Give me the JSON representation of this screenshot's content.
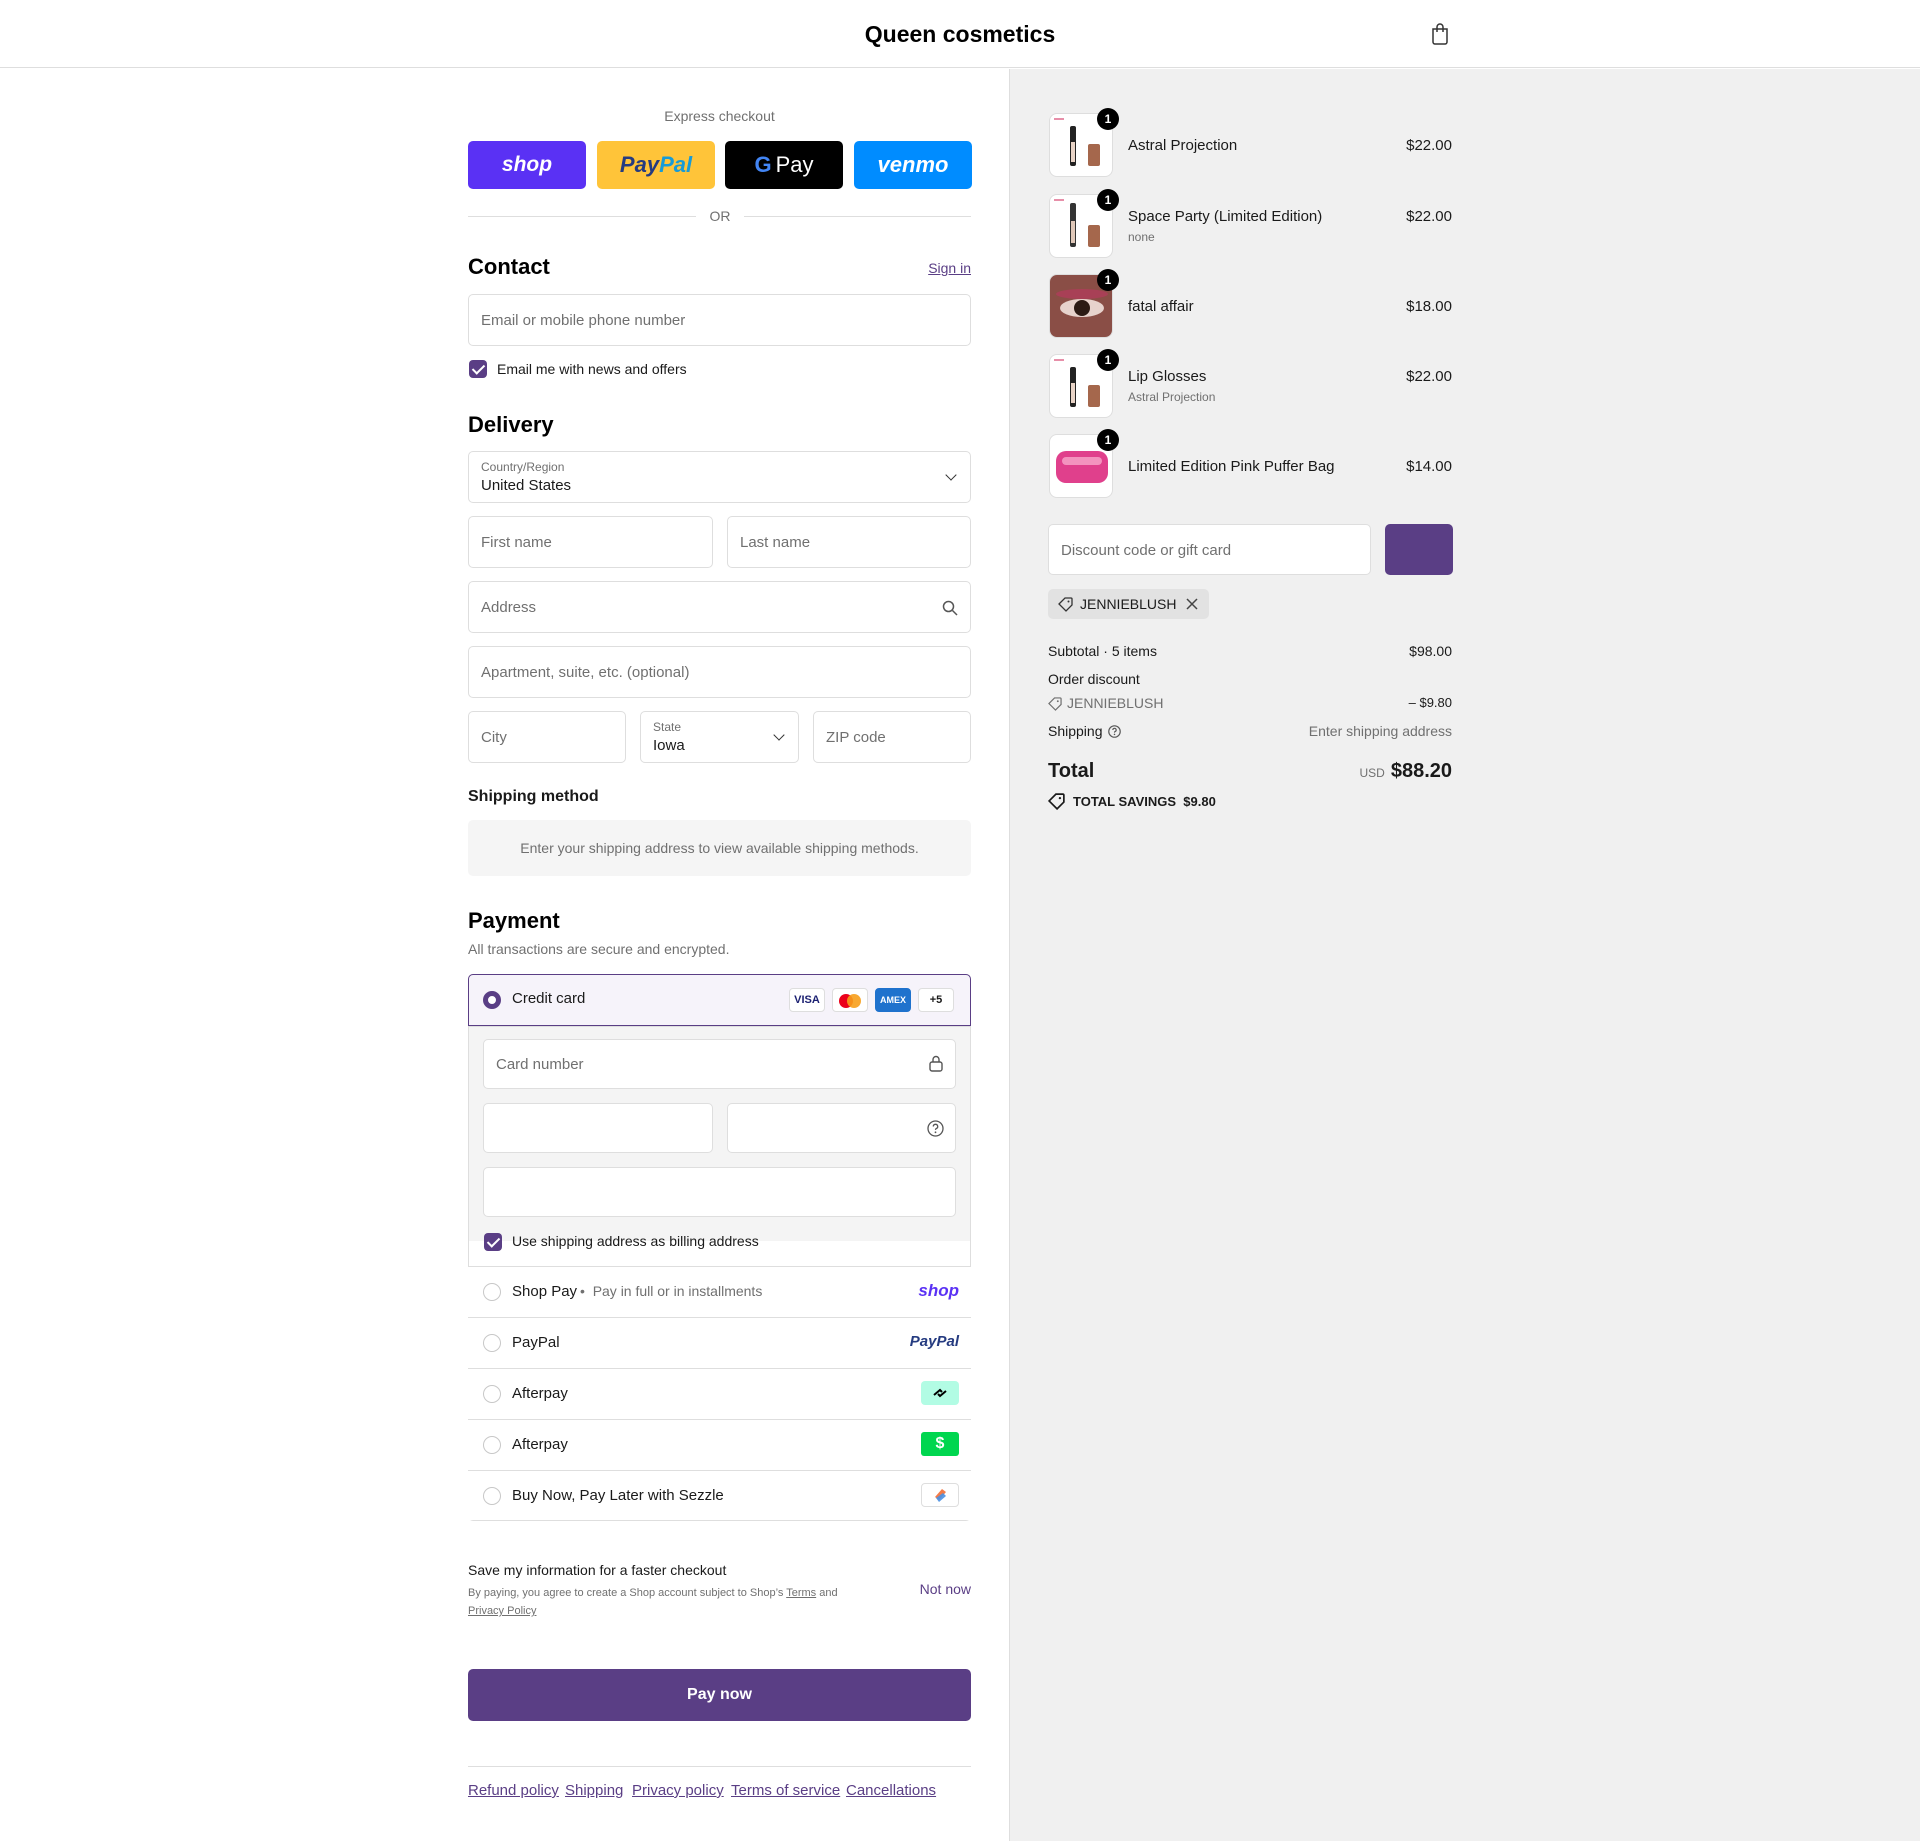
{
  "header": {
    "brand": "Queen cosmetics",
    "cart_icon": "shopping-bag-icon"
  },
  "express": {
    "title": "Express checkout",
    "buttons": {
      "shop": "shop",
      "paypal_pay": "Pay",
      "paypal_pal": "Pal",
      "gpay_g": "G",
      "gpay": "Pay",
      "venmo": "venmo"
    },
    "colors": {
      "shop": "#5a31f4",
      "paypal": "#ffc439",
      "gpay": "#000000",
      "venmo": "#008cff"
    },
    "or": "OR"
  },
  "contact": {
    "title": "Contact",
    "sign_in": "Sign in",
    "email_placeholder": "Email or mobile phone number",
    "news_checkbox": "Email me with news and offers",
    "news_checked": true
  },
  "delivery": {
    "title": "Delivery",
    "country_label": "Country/Region",
    "country_value": "United States",
    "first_name": "First name",
    "last_name": "Last name",
    "address": "Address",
    "apartment": "Apartment, suite, etc. (optional)",
    "city": "City",
    "state_label": "State",
    "state_value": "Iowa",
    "zip": "ZIP code"
  },
  "shipping_method": {
    "title": "Shipping method",
    "notice": "Enter your shipping address to view available shipping methods."
  },
  "payment": {
    "title": "Payment",
    "subtitle": "All transactions are secure and encrypted.",
    "credit_card": "Credit card",
    "card_brands": [
      "VISA",
      "MC",
      "AMEX",
      "+5"
    ],
    "card_number": "Card number",
    "billing_checkbox": "Use shipping address as billing address",
    "options": [
      {
        "label": "Shop Pay",
        "sub": "Pay in full or in installments",
        "logo": "shop"
      },
      {
        "label": "PayPal",
        "logo": "PayPal"
      },
      {
        "label": "Afterpay",
        "logo": "afterpay-icon"
      },
      {
        "label": "Afterpay",
        "logo": "cash-app-icon"
      },
      {
        "label": "Buy Now, Pay Later with Sezzle",
        "logo": "sezzle-icon"
      }
    ]
  },
  "save_info": {
    "title": "Save my information for a faster checkout",
    "terms_prefix": "By paying, you agree to create a Shop account subject to Shop’s",
    "terms_link": "Terms",
    "terms_and": "and",
    "privacy_link": "Privacy Policy",
    "not_now": "Not now"
  },
  "pay_now": "Pay now",
  "accent_color": "#5a3e85",
  "footer_links": [
    "Refund policy",
    "Shipping",
    "Privacy policy",
    "Terms of service",
    "Cancellations"
  ],
  "order": {
    "items": [
      {
        "name": "Astral Projection",
        "variant": "",
        "price": "$22.00",
        "qty": "1"
      },
      {
        "name": "Space Party (Limited Edition)",
        "variant": "none",
        "price": "$22.00",
        "qty": "1"
      },
      {
        "name": "fatal affair",
        "variant": "",
        "price": "$18.00",
        "qty": "1"
      },
      {
        "name": "Lip Glosses",
        "variant": "Astral Projection",
        "price": "$22.00",
        "qty": "1"
      },
      {
        "name": "Limited Edition Pink Puffer Bag",
        "variant": "",
        "price": "$14.00",
        "qty": "1"
      }
    ],
    "discount_placeholder": "Discount code or gift card",
    "applied_code": "JENNIEBLUSH",
    "subtotal_label": "Subtotal · 5 items",
    "subtotal": "$98.00",
    "order_discount_label": "Order discount",
    "discount_code": "JENNIEBLUSH",
    "discount_amount": "– $9.80",
    "shipping_label": "Shipping",
    "shipping_value": "Enter shipping address",
    "total_label": "Total",
    "currency": "USD",
    "total": "$88.20",
    "savings_label": "TOTAL SAVINGS",
    "savings": "$9.80"
  }
}
